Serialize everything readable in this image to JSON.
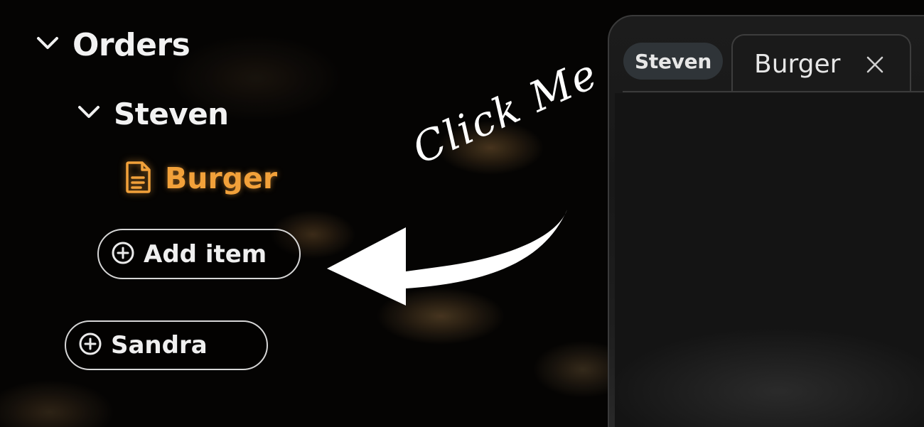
{
  "tree": {
    "root_label": "Orders",
    "group_label": "Steven",
    "item_label": "Burger",
    "add_item_label": "Add item",
    "other_group_label": "Sandra"
  },
  "annotation": {
    "text": "Click Me"
  },
  "window": {
    "user_chip_label": "Steven",
    "tab_label": "Burger"
  },
  "colors": {
    "accent_orange": "#f2a13a",
    "text_white": "#f2f2f2",
    "chip_bg": "#2f3438"
  },
  "icons": {
    "expand": "chevron-down-icon",
    "document": "document-icon",
    "add": "plus-circle-icon",
    "close": "close-icon"
  }
}
